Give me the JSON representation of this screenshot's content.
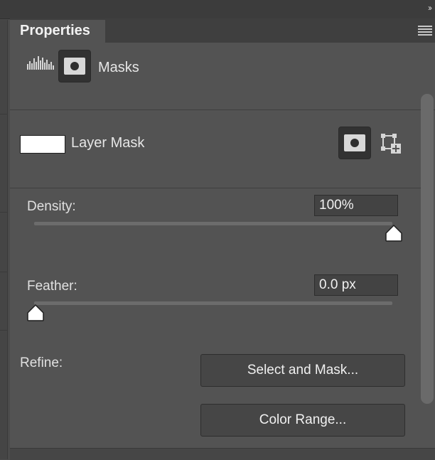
{
  "panel": {
    "tab_title": "Properties"
  },
  "header": {
    "masks_label": "Masks"
  },
  "layer": {
    "label": "Layer Mask"
  },
  "density": {
    "label": "Density:",
    "value": "100%",
    "slider_fraction": 1.0
  },
  "feather": {
    "label": "Feather:",
    "value": "0.0 px",
    "slider_fraction": 0.0
  },
  "refine": {
    "label": "Refine:",
    "select_and_mask": "Select and Mask...",
    "color_range": "Color Range..."
  },
  "icons": {
    "collapse": "double-chevron-right-icon",
    "menu": "hamburger-menu-icon",
    "histogram": "pixel-mask-histogram-icon",
    "mask": "layer-mask-icon",
    "vector_mask": "add-vector-mask-icon"
  }
}
